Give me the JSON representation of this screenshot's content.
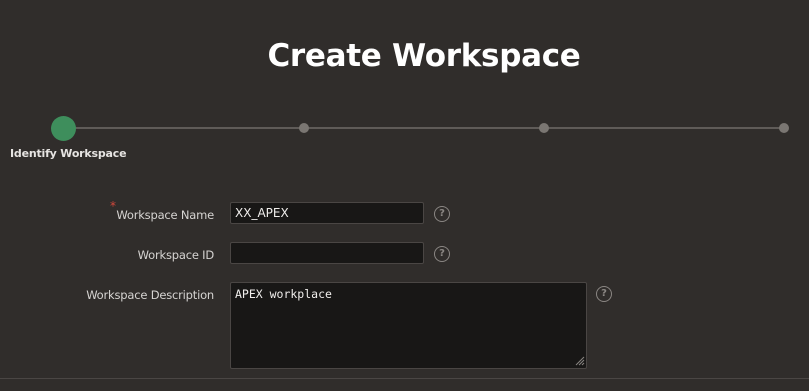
{
  "page": {
    "title": "Create Workspace"
  },
  "wizard": {
    "current_step_label": "Identify Workspace",
    "current_step_color": "#3e8e5c",
    "steps_total": 4
  },
  "form": {
    "workspace_name": {
      "label": "Workspace Name",
      "value": "XX_APEX",
      "required": true,
      "help_icon": "help-icon"
    },
    "workspace_id": {
      "label": "Workspace ID",
      "value": "",
      "help_icon": "help-icon"
    },
    "workspace_description": {
      "label": "Workspace Description",
      "value": "APEX workplace",
      "help_icon": "help-icon"
    },
    "required_marker": "*",
    "help_glyph": "?"
  }
}
